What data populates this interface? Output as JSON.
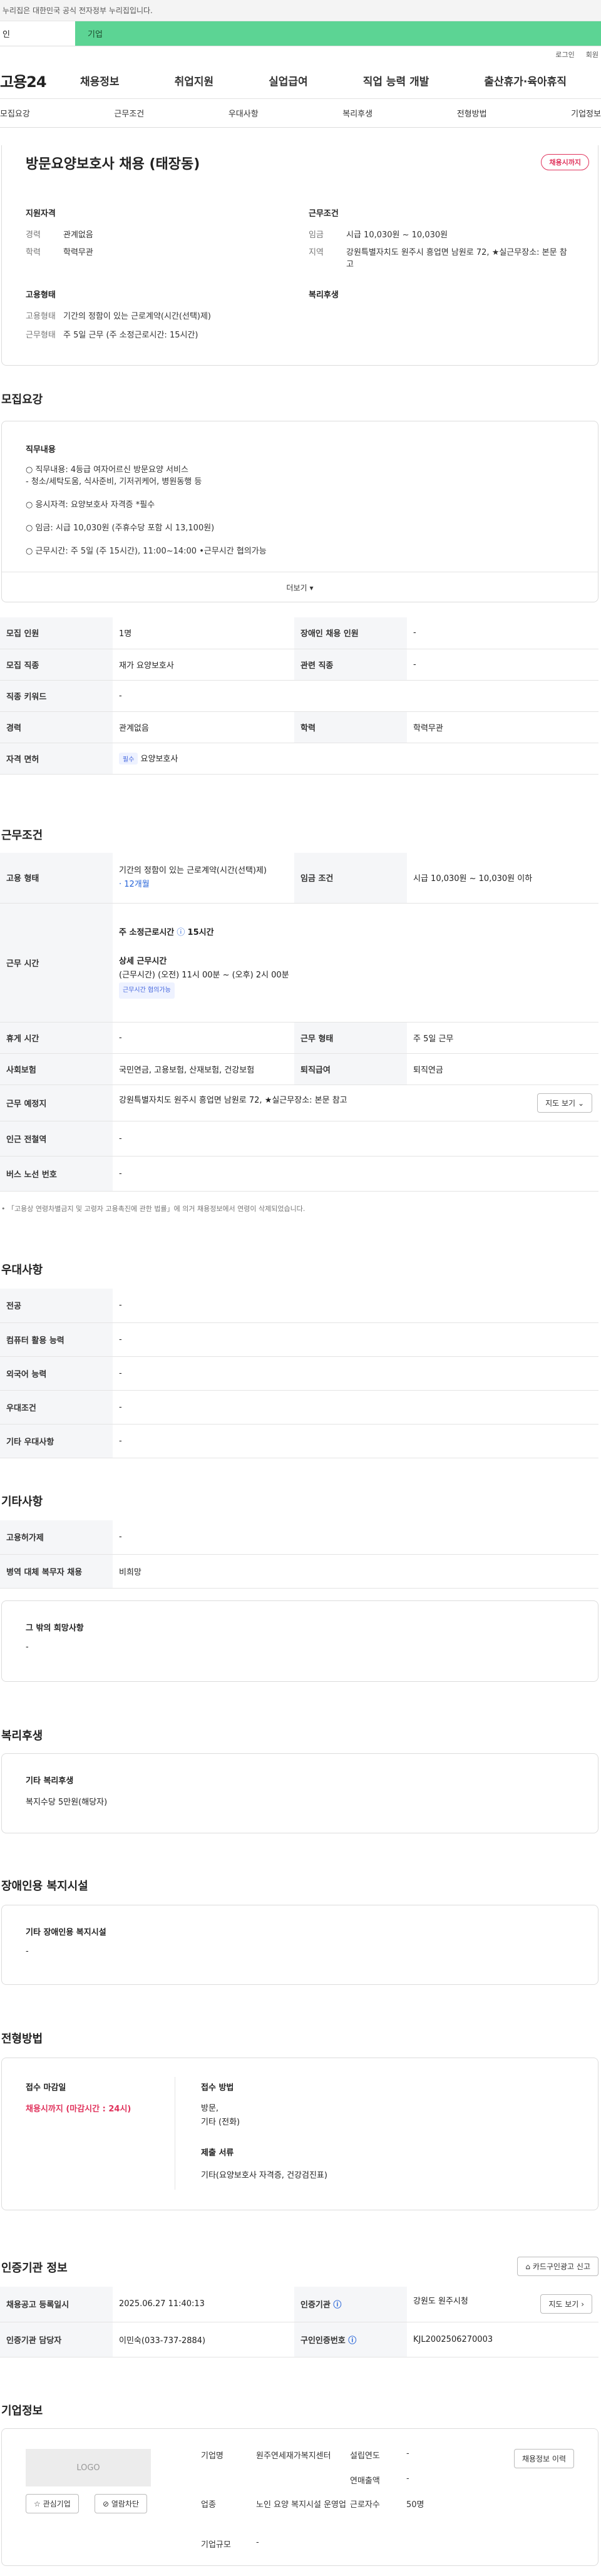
{
  "notice": "누리집은 대한민국 공식 전자정부 누리집입니다.",
  "gtabs": {
    "personal": "인",
    "company": "기업"
  },
  "util": {
    "login": "로그인",
    "join": "회원"
  },
  "gnb": {
    "logo": "고용24",
    "items": [
      "채용정보",
      "취업지원",
      "실업급여",
      "직업 능력 개발",
      "출산휴가·육아휴직"
    ]
  },
  "subnav": [
    "모집요강",
    "근무조건",
    "우대사항",
    "복리후생",
    "전형방법",
    "기업정보"
  ],
  "job": {
    "title": "방문요양보호사 채용 (태장동)",
    "status": "채용시까지"
  },
  "summary": {
    "qual_title": "지원자격",
    "cond_title": "근무조건",
    "career_k": "경력",
    "career_v": "관계없음",
    "edu_k": "학력",
    "edu_v": "학력무관",
    "wage_k": "임금",
    "wage_v": "시급 10,030원 ~ 10,030원",
    "region_k": "지역",
    "region_v": "강원특별자치도 원주시 흥업면 남원로 72, ★실근무장소: 본문 참고",
    "emp_title": "고용형태",
    "welfare_title": "복리후생",
    "emptype_k": "고용형태",
    "emptype_v": "기간의 정함이 있는 근로계약(시간(선택)제)",
    "worktype_k": "근무형태",
    "worktype_v": "주 5일 근무 (주 소정근로시간: 15시간)"
  },
  "recruit": {
    "title": "모집요강",
    "duty_title": "직무내용",
    "lines": [
      "○ 직무내용: 4등급 여자어르신 방문요양 서비스",
      "- 청소/세탁도움, 식사준비, 기저귀케어, 병원동행 등",
      "○ 응시자격: 요양보호사 자격증 *필수",
      "○ 임금: 시급 10,030원 (주휴수당 포함 시 13,100원)",
      "○ 근무시간: 주 5일 (주 15시간), 11:00~14:00 •근무시간 협의가능"
    ],
    "more": "더보기",
    "rows": [
      [
        "모집 인원",
        "1명",
        "장애인 채용 인원",
        "-"
      ],
      [
        "모집 직종",
        "재가 요양보호사",
        "관련 직종",
        "-"
      ],
      [
        "직종 키워드",
        "-",
        "",
        ""
      ],
      [
        "경력",
        "관계없음",
        "학력",
        "학력무관"
      ]
    ],
    "license_k": "자격 면허",
    "license_tag": "필수",
    "license_v": "요양보호사"
  },
  "conditions": {
    "title": "근무조건",
    "emp_k": "고용 형태",
    "emp_v": "기간의 정함이 있는 근로계약(시간(선택)제)",
    "emp_sub": "· 12개월",
    "wage_k": "임금 조건",
    "wage_v": "시급 10,030원 ~ 10,030원 이하",
    "time_k": "근무 시간",
    "time_main": "주 소정근로시간",
    "time_hours": "15시간",
    "time_detail_t": "상세 근무시간",
    "time_detail": "(근무시간) (오전) 11시 00분 ~ (오후) 2시 00분",
    "time_tag": "근무시간 협의가능",
    "rest_k": "휴게 시간",
    "rest_v": "-",
    "shape_k": "근무 형태",
    "shape_v": "주 5일 근무",
    "ins_k": "사회보험",
    "ins_v": "국민연금, 고용보험, 산재보험, 건강보험",
    "ret_k": "퇴직급여",
    "ret_v": "퇴직연금",
    "place_k": "근무 예정지",
    "place_v": "강원특별자치도 원주시 흥업면 남원로 72, ★실근무장소: 본문 참고",
    "map": "지도 보기",
    "sub_k": "인근 전철역",
    "sub_v": "-",
    "bus_k": "버스 노선 번호",
    "bus_v": "-",
    "note": "• 「고용상 연령차별금지 및 고령자 고용촉진에 관한 법률」에 의거 채용정보에서 연령이 삭제되었습니다."
  },
  "preference": {
    "title": "우대사항",
    "rows": [
      [
        "전공",
        "-"
      ],
      [
        "컴퓨터 활용 능력",
        "-"
      ],
      [
        "외국어 능력",
        "-"
      ],
      [
        "우대조건",
        "-"
      ],
      [
        "기타 우대사항",
        "-"
      ]
    ]
  },
  "etc": {
    "title": "기타사항",
    "rows": [
      [
        "고용허가제",
        "-"
      ],
      [
        "병역 대체 복무자 채용",
        "비희망"
      ]
    ],
    "wish_t": "그 밖의 희망사항",
    "wish_v": "-"
  },
  "welfare": {
    "title": "복리후생",
    "box_t": "기타 복리후생",
    "box_v": "복지수당 5만원(해당자)"
  },
  "disabled": {
    "title": "장애인용 복지시설",
    "box_t": "기타 장애인용 복지시설",
    "box_v": "-"
  },
  "selection": {
    "title": "전형방법",
    "deadline_t": "접수 마감일",
    "deadline_v": "채용시까지 (마감시간 : 24시)",
    "method_t": "접수 방법",
    "method_v1": "방문,",
    "method_v2": "기타 (전화)",
    "docs_t": "제출 서류",
    "docs_v": "기타(요양보호사 자격증, 건강검진표)"
  },
  "cert": {
    "title": "인증기관 정보",
    "copy": "카드구인광고 신고",
    "rows": [
      [
        "채용공고 등록일시",
        "2025.06.27 11:40:13",
        "인증기관",
        "강원도 원주시청"
      ],
      [
        "인증기관 담당자",
        "이민숙(033-737-2884)",
        "구인인증번호",
        "KJL2002506270003"
      ]
    ],
    "map": "지도 보기"
  },
  "company": {
    "title": "기업정보",
    "logo": "LOGO",
    "fav": "관심기업",
    "block": "열람차단",
    "name_k": "기업명",
    "name_v": "원주연세재가복지센터",
    "ind_k": "업종",
    "ind_v": "노인 요양 복지시설 운영업",
    "size_k": "기업규모",
    "size_v": "-",
    "est_k": "설립연도",
    "est_v": "-",
    "sales_k": "연매출액",
    "sales_v": "-",
    "emp_k": "근로자수",
    "emp_v": "50명",
    "btn": "채용정보 이력"
  }
}
